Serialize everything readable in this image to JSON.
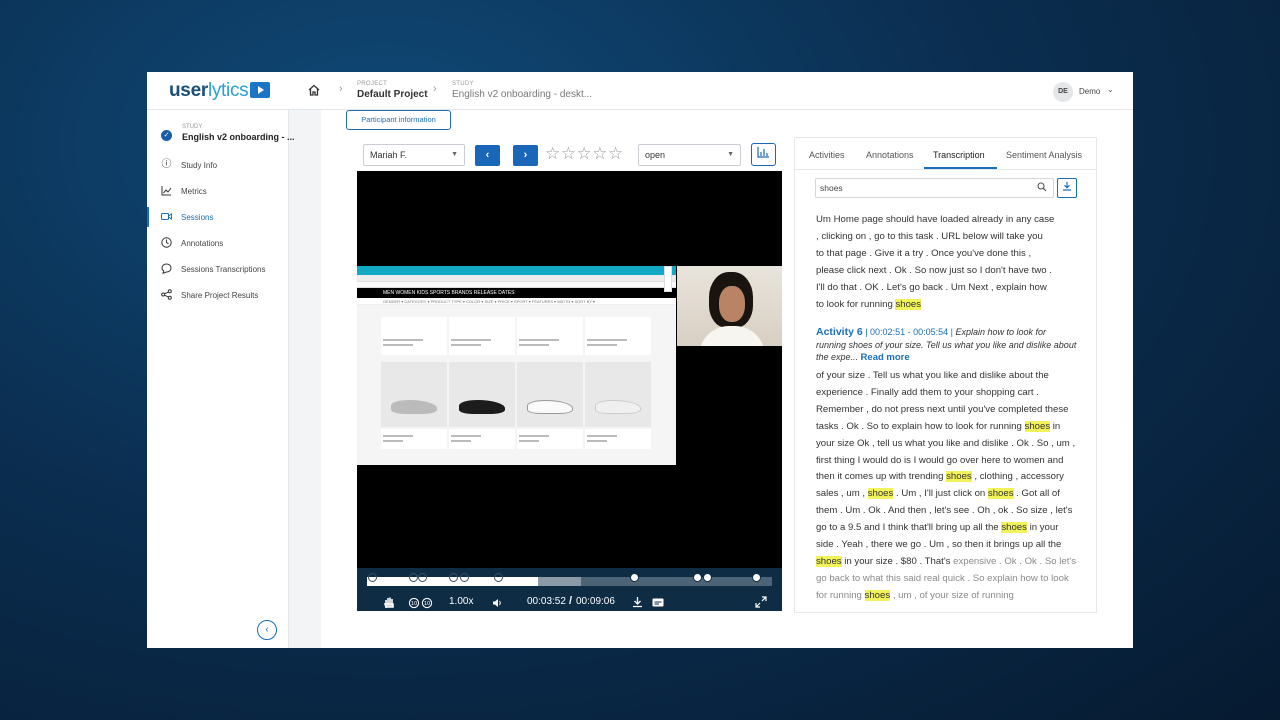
{
  "brand": {
    "name_dark": "user",
    "name_light": "lytics"
  },
  "breadcrumb": [
    {
      "label": "PROJECT",
      "value": "Default Project"
    },
    {
      "label": "STUDY",
      "value": "English v2 onboarding - deskt..."
    }
  ],
  "user": {
    "initials": "DE",
    "name": "Demo"
  },
  "sidebar": {
    "study_label": "STUDY",
    "study_value": "English v2 onboarding - ...",
    "items": [
      {
        "label": "Study Info",
        "icon": "info-icon"
      },
      {
        "label": "Metrics",
        "icon": "chart-icon"
      },
      {
        "label": "Sessions",
        "icon": "video-icon",
        "active": true
      },
      {
        "label": "Annotations",
        "icon": "clock-icon"
      },
      {
        "label": "Sessions Transcriptions",
        "icon": "chat-icon"
      },
      {
        "label": "Share Project Results",
        "icon": "share-icon"
      }
    ]
  },
  "participant_info_label": "Participant information",
  "player": {
    "participant": "Mariah F.",
    "status": "open",
    "rating_max": 5,
    "rating_value": 0,
    "speed": "1.00x",
    "current_time": "00:03:52",
    "separator": "/",
    "total_time": "00:09:06",
    "progress_fraction": 0.425
  },
  "transcript": {
    "tabs": [
      "Activities",
      "Annotations",
      "Transcription",
      "Sentiment Analysis"
    ],
    "active_tab": "Transcription",
    "search_value": "shoes",
    "block1": [
      "Um Home page should have loaded already in any case",
      ", clicking on , go to this task . URL below will take you",
      "to that page . Give it a try . Once you've done this ,",
      "please click next . Ok . So now just so I don't have two .",
      "I'll do that . OK . Let's go back . Um Next , explain how",
      "to look for running "
    ],
    "highlight": "shoes",
    "activity": {
      "title": "Activity 6",
      "time": "| 00:02:51 - 00:05:54 |",
      "desc": "Explain how to look for running shoes of your size. Tell us what you like and dislike about the expe...",
      "more": "Read more"
    },
    "block2_a": "of your size . Tell us what you like and dislike about the experience . Finally add them to your shopping cart . Remember , do not press next until you've completed these tasks . Ok . So to explain how to look for running ",
    "block2_b": " in your size Ok , tell us what you like and dislike . Ok . So , um , first thing I would do is I would go over here to women and then it comes up with trending ",
    "block2_c": " , clothing , accessory sales , um , ",
    "block2_d": " . Um , I'll just click on ",
    "block2_e": " . Got all of them . Um . Ok . And then , let's see . Oh , ok . So size , let's go to a 9.5 and I think that'll bring up all the ",
    "block2_f": " in your side . Yeah , there we go . Um , so then it brings up all the ",
    "block2_g": " in your size . $80 . That's ",
    "block2_dim": "expensive . Ok . Ok . So let's go back to what this said real quick . So explain how to look for running",
    "block2_h": " , um , of your size of running"
  },
  "webpage": {
    "nav_text": "MEN  WOMEN  KIDS  SPORTS  BRANDS  RELEASE DATES",
    "filter_text": "GENDER ▾  CATEGORY ▾  PRODUCT TYPE ▾  COLOR ▾  SIZE ▾  PRICE ▾  SPORT ▾  FEATURES ▾  WIDTH ▾  SORT BY ▾"
  },
  "colors": {
    "accent": "#1a6fb8",
    "highlight": "#f2f25a",
    "timeline_bg": "#0f2c45"
  }
}
